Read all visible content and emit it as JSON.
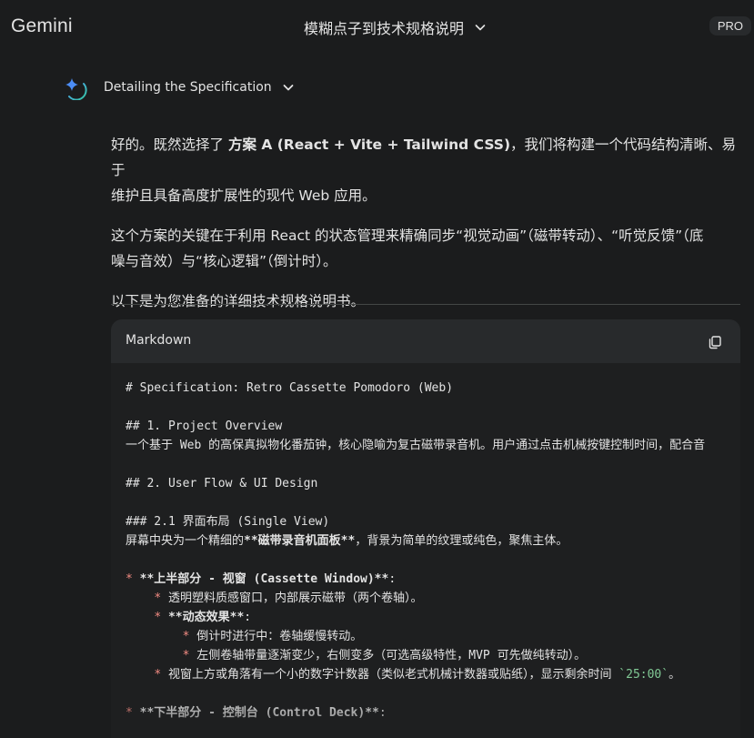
{
  "app": {
    "brand": "Gemini",
    "badge": "PRO"
  },
  "conversation": {
    "title": "模糊点子到技术规格说明"
  },
  "thinking": {
    "label": "Detailing the Specification"
  },
  "response": {
    "p1": {
      "a": "好的。既然选择了 ",
      "b": "方案 A (React + Vite + Tailwind CSS)",
      "c": "，我们将构建一个代码结构清晰、易于",
      "d": "维护且具备高度扩展性的现代 Web 应用。"
    },
    "p2": {
      "a": "这个方案的关键在于利用 React 的状态管理来精确同步“视觉动画”（磁带转动）、“听觉反馈”（底",
      "b": "噪与音效）与“核心逻辑”（倒计时）。"
    },
    "p3": "以下是为您准备的详细技术规格说明书。"
  },
  "code_block": {
    "language": "Markdown",
    "lines": {
      "l1": "# Specification: Retro Cassette Pomodoro (Web)",
      "l2": "## 1. Project Overview",
      "l3": "一个基于 Web 的高保真拟物化番茄钟，核心隐喻为复古磁带录音机。用户通过点击机械按键控制时间，配合音",
      "l4": "## 2. User Flow & UI Design",
      "l5": "### 2.1 界面布局 (Single View)",
      "l6a": "屏幕中央为一个精细的",
      "l6b": "**磁带录音机面板**",
      "l6c": "，背景为简单的纹理或纯色，聚焦主体。",
      "l7bullet": "*",
      "l7text": "**上半部分 - 视窗 (Cassette Window)**",
      "l7colon": ":",
      "l8bullet": "*",
      "l8text": "透明塑料质感窗口，内部展示磁带（两个卷轴）。",
      "l9bullet": "*",
      "l9text": "**动态效果**",
      "l9colon": ":",
      "l10bullet": "*",
      "l10text": "倒计时进行中：卷轴缓慢转动。",
      "l11bullet": "*",
      "l11text": "左侧卷轴带量逐渐变少，右侧变多（可选高级特性，MVP 可先做纯转动）。",
      "l12bullet": "*",
      "l12text": "视窗上方或角落有一个小的数字计数器（类似老式机械计数器或贴纸），显示剩余时间 ",
      "l12code": "`25:00`",
      "l12end": "。",
      "l13bullet": "*",
      "l13text": "**下半部分 - 控制台 (Control Deck)**",
      "l13colon": ":"
    }
  },
  "colors": {
    "background": "#1b1c1d",
    "code_background": "#1e1f20",
    "code_header": "#282a2c",
    "markdown_red": "#f28b82",
    "inline_code_green": "#81c995"
  }
}
